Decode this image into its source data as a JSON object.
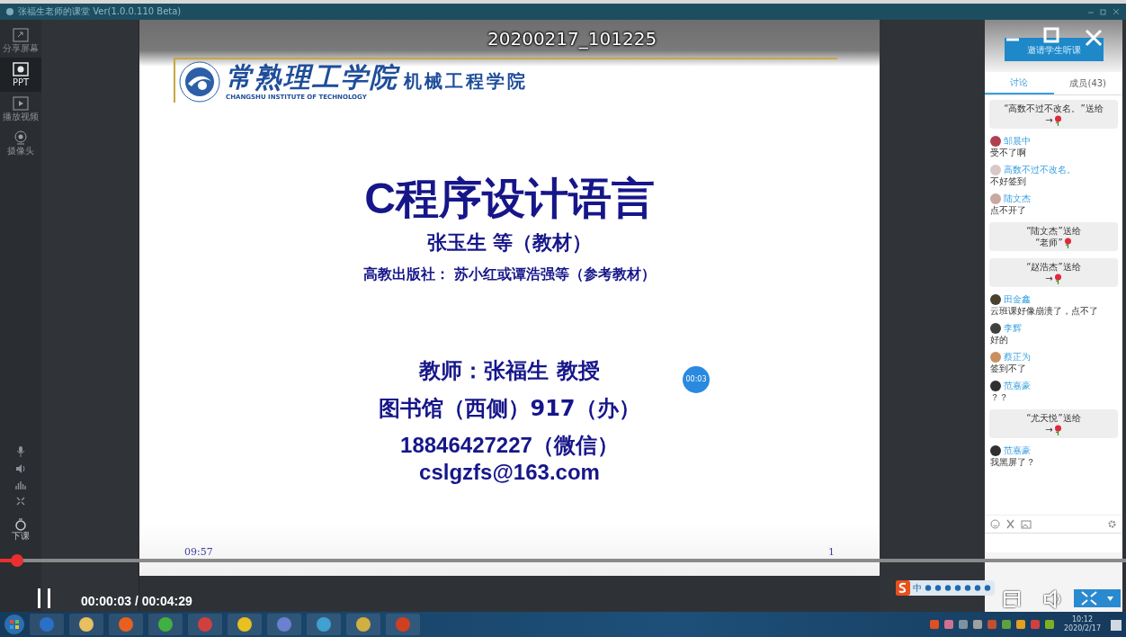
{
  "app_window": {
    "title": "张福生老师的课堂 Ver(1.0.0.110 Beta)",
    "sidebar": [
      {
        "label": "分享屏幕",
        "kind": "share",
        "selected": false
      },
      {
        "label": "PPT",
        "kind": "ppt",
        "selected": true
      },
      {
        "label": "播放视频",
        "kind": "video",
        "selected": false
      },
      {
        "label": "摄像头",
        "kind": "camera",
        "selected": false
      }
    ],
    "end_class": "下课"
  },
  "video_overlay": {
    "timestamp": "20200217_101225",
    "badge": "00:03"
  },
  "slide": {
    "school_cn": "常熟理工学院",
    "school_en": "CHANGSHU INSTITUTE OF TECHNOLOGY",
    "department": "机械工程学院",
    "title": "C程序设计语言",
    "author": "张玉生 等（教材）",
    "publisher": "高教出版社： 苏小红或谭浩强等（参考教材）",
    "teacher": "教师：张福生 教授",
    "office": "图书馆（西侧）917（办）",
    "phone": "18846427227（微信）",
    "email": "cslgzfs@163.com",
    "footer_time": "09:57",
    "page": "1"
  },
  "chat": {
    "invite_button": "邀请学生听课",
    "tabs": [
      {
        "label": "讨论",
        "selected": true
      },
      {
        "label": "成员(43)",
        "selected": false
      }
    ],
    "messages": [
      {
        "kind": "gift",
        "line1": "“高数不过不改名。”送给",
        "line2": "→"
      },
      {
        "kind": "message",
        "name": "邹晨中",
        "text": "受不了啊",
        "color": "#b04050"
      },
      {
        "kind": "message",
        "name": "高数不过不改名。",
        "text": "不好签到",
        "color": "#d8c8c8"
      },
      {
        "kind": "message",
        "name": "陆文杰",
        "text": "点不开了",
        "color": "#c8a8a0"
      },
      {
        "kind": "gift",
        "line1": "“陆文杰”送给",
        "line2": "“老师”"
      },
      {
        "kind": "gift",
        "line1": "“赵浩杰”送给",
        "line2": "→"
      },
      {
        "kind": "message",
        "name": "田金鑫",
        "text": "云班课好像崩溃了，点不了",
        "color": "#4a4030"
      },
      {
        "kind": "message",
        "name": "李辉",
        "text": "好的",
        "color": "#404040"
      },
      {
        "kind": "message",
        "name": "蔡正为",
        "text": "签到不了",
        "color": "#c89060"
      },
      {
        "kind": "message",
        "name": "范嘉豪",
        "text": "？？",
        "color": "#303030"
      },
      {
        "kind": "gift",
        "line1": "“尤天悦”送给",
        "line2": "→"
      },
      {
        "kind": "message",
        "name": "范嘉豪",
        "text": "我黑屏了？",
        "color": "#303030"
      }
    ]
  },
  "player": {
    "time": "00:00:03 / 00:04:29",
    "level": 0.015,
    "playing": true
  },
  "ime": {
    "mode": "中"
  },
  "taskbar": {
    "time": "10:12",
    "date": "2020/2/17"
  }
}
